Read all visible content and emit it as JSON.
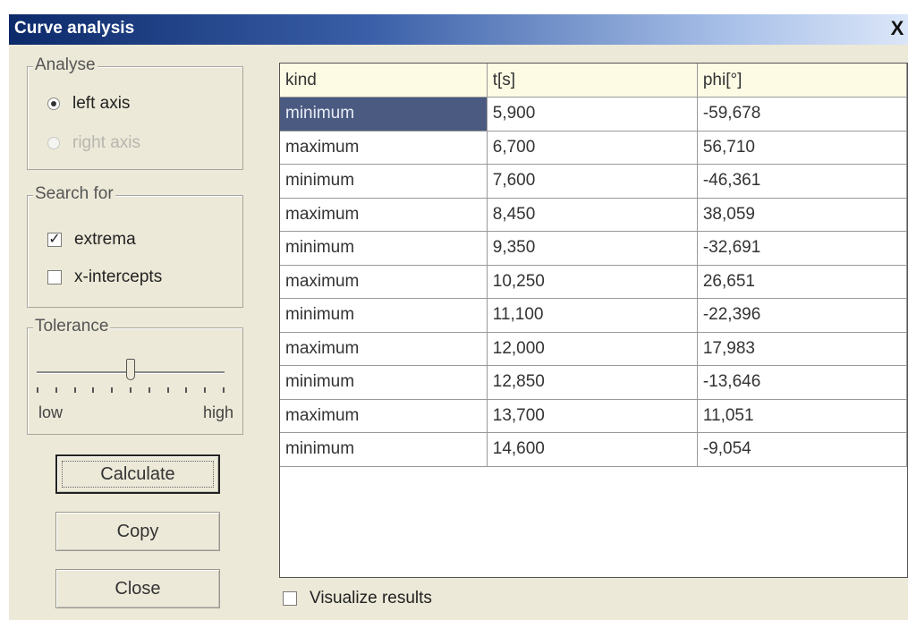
{
  "window": {
    "title": "Curve analysis",
    "close_glyph": "X"
  },
  "analyse": {
    "label": "Analyse",
    "options": [
      {
        "label": "left axis",
        "checked": true,
        "disabled": false
      },
      {
        "label": "right axis",
        "checked": false,
        "disabled": true
      }
    ]
  },
  "search_for": {
    "label": "Search for",
    "options": [
      {
        "label": "extrema",
        "checked": true
      },
      {
        "label": "x-intercepts",
        "checked": false
      }
    ]
  },
  "tolerance": {
    "label": "Tolerance",
    "low": "low",
    "high": "high",
    "level": 0.5
  },
  "buttons": {
    "calculate": "Calculate",
    "copy": "Copy",
    "close": "Close"
  },
  "table": {
    "headers": [
      "kind",
      "t[s]",
      "phi[°]"
    ],
    "rows": [
      [
        "minimum",
        "5,900",
        "-59,678"
      ],
      [
        "maximum",
        "6,700",
        "56,710"
      ],
      [
        "minimum",
        "7,600",
        "-46,361"
      ],
      [
        "maximum",
        "8,450",
        "38,059"
      ],
      [
        "minimum",
        "9,350",
        "-32,691"
      ],
      [
        "maximum",
        "10,250",
        "26,651"
      ],
      [
        "minimum",
        "11,100",
        "-22,396"
      ],
      [
        "maximum",
        "12,000",
        "17,983"
      ],
      [
        "minimum",
        "12,850",
        "-13,646"
      ],
      [
        "maximum",
        "13,700",
        "11,051"
      ],
      [
        "minimum",
        "14,600",
        "-9,054"
      ]
    ]
  },
  "visualize": {
    "label": "Visualize results",
    "checked": false
  }
}
